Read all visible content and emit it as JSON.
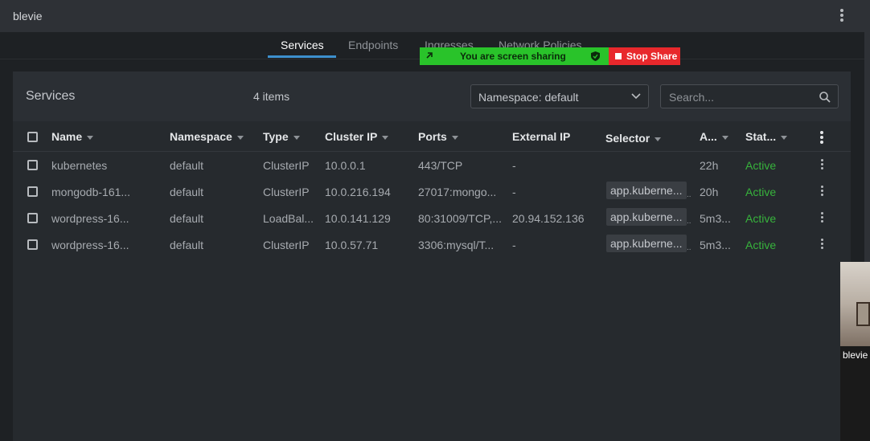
{
  "window": {
    "title": "blevie"
  },
  "tabs": [
    {
      "label": "Services",
      "active": true
    },
    {
      "label": "Endpoints",
      "active": false
    },
    {
      "label": "Ingresses",
      "active": false
    },
    {
      "label": "Network Policies",
      "active": false
    }
  ],
  "share_bar": {
    "status": "You are screen sharing",
    "stop_label": "Stop Share"
  },
  "panel": {
    "title": "Services",
    "count": "4 items",
    "namespace_select": "Namespace: default",
    "search_placeholder": "Search..."
  },
  "table": {
    "columns": [
      "Name",
      "Namespace",
      "Type",
      "Cluster IP",
      "Ports",
      "External IP",
      "Selector",
      "A...",
      "Stat..."
    ],
    "rows": [
      {
        "name": "kubernetes",
        "namespace": "default",
        "type": "ClusterIP",
        "cluster_ip": "10.0.0.1",
        "ports": "443/TCP",
        "external_ip": "-",
        "selector": "",
        "age": "22h",
        "status": "Active"
      },
      {
        "name": "mongodb-161...",
        "namespace": "default",
        "type": "ClusterIP",
        "cluster_ip": "10.0.216.194",
        "ports": "27017:mongo...",
        "external_ip": "-",
        "selector": "app.kuberne...",
        "age": "20h",
        "status": "Active"
      },
      {
        "name": "wordpress-16...",
        "namespace": "default",
        "type": "LoadBal...",
        "cluster_ip": "10.0.141.129",
        "ports": "80:31009/TCP,...",
        "external_ip": "20.94.152.136",
        "selector": "app.kuberne...",
        "age": "5m3...",
        "status": "Active"
      },
      {
        "name": "wordpress-16...",
        "namespace": "default",
        "type": "ClusterIP",
        "cluster_ip": "10.0.57.71",
        "ports": "3306:mysql/T...",
        "external_ip": "-",
        "selector": "app.kuberne...",
        "age": "5m3...",
        "status": "Active"
      }
    ]
  },
  "webcam": {
    "name": "blevie"
  },
  "colors": {
    "accent": "#3d90ce",
    "status_active": "#37b33c",
    "share_green": "#29c32a",
    "share_red": "#e8282c"
  }
}
